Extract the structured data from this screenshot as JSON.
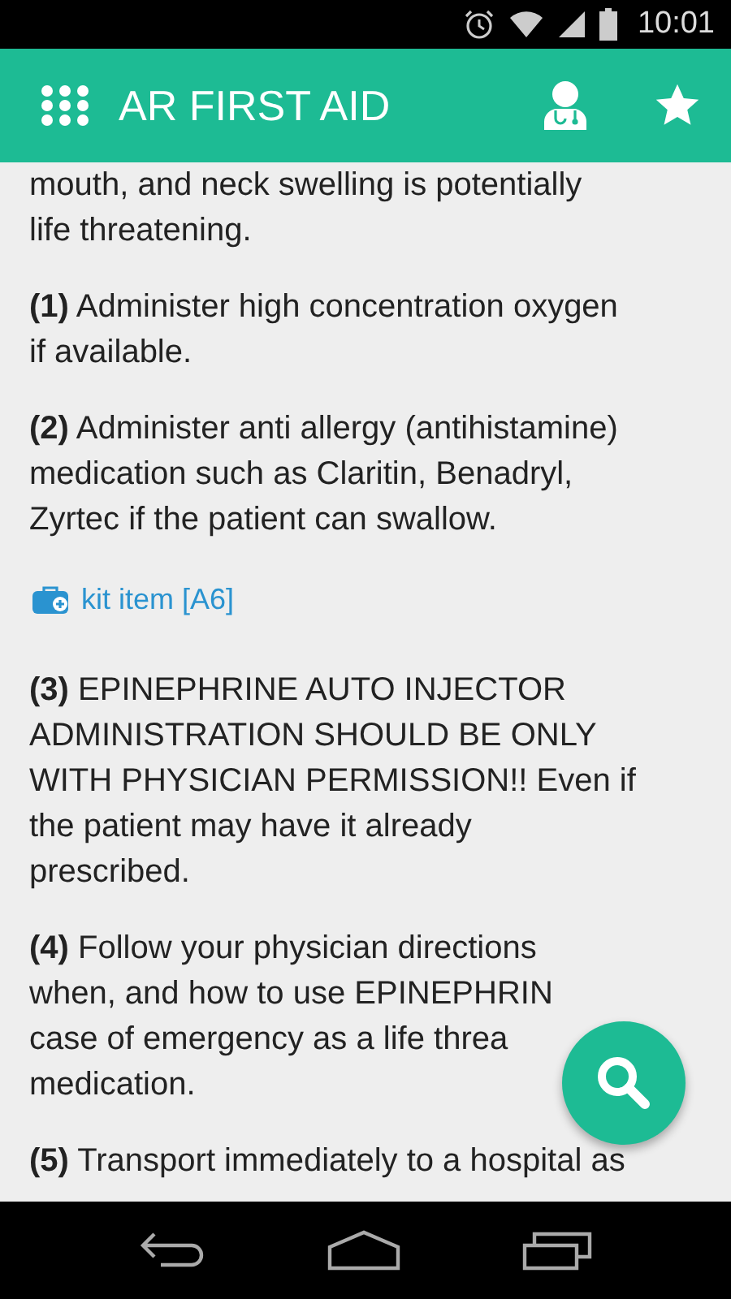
{
  "status_bar": {
    "time": "10:01"
  },
  "app_bar": {
    "title": "AR FIRST AID"
  },
  "content": [
    {
      "kind": "text",
      "lines": [
        "mouth, and neck swelling is potentially",
        "life threatening."
      ]
    },
    {
      "kind": "step",
      "number": "(1)",
      "lines": [
        "Administer high concentration oxygen",
        "if available."
      ]
    },
    {
      "kind": "step",
      "number": "(2)",
      "lines": [
        "Administer anti allergy (antihistamine)",
        "medication such as Claritin, Benadryl,",
        "Zyrtec if the patient can swallow."
      ]
    },
    {
      "kind": "kit",
      "label": "kit item [A6]"
    },
    {
      "kind": "step",
      "number": "(3)",
      "lines": [
        "EPINEPHRINE AUTO INJECTOR",
        "ADMINISTRATION SHOULD BE ONLY",
        "WITH PHYSICIAN PERMISSION!! Even if",
        "the patient may have it already",
        "prescribed."
      ]
    },
    {
      "kind": "step",
      "number": "(4)",
      "lines": [
        "Follow your physician directions",
        "when, and how to use EPINEPHRIN",
        "case of emergency as a life threa",
        "medication."
      ]
    },
    {
      "kind": "step",
      "number": "(5)",
      "lines": [
        "Transport immediately to a hospital as"
      ]
    }
  ]
}
